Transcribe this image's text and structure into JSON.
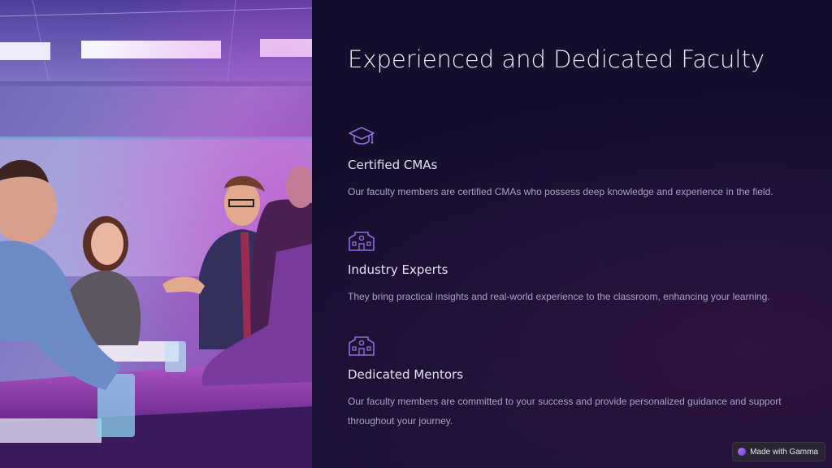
{
  "slide": {
    "title": "Experienced and Dedicated Faculty",
    "features": [
      {
        "icon": "graduation-cap-icon",
        "title": "Certified CMAs",
        "description": "Our faculty members are certified CMAs who possess deep knowledge and experience in the field."
      },
      {
        "icon": "building-icon",
        "title": "Industry Experts",
        "description": "They bring practical insights and real-world experience to the classroom, enhancing your learning."
      },
      {
        "icon": "building-icon",
        "title": "Dedicated Mentors",
        "description": "Our faculty members are committed to your success and provide personalized guidance and support throughout your journey."
      }
    ]
  },
  "badge": {
    "label": "Made with Gamma"
  },
  "colors": {
    "background": "#120d2a",
    "accent": "#8e6dd8",
    "heading": "#f1edf9",
    "body_text": "#a9a2c2"
  }
}
